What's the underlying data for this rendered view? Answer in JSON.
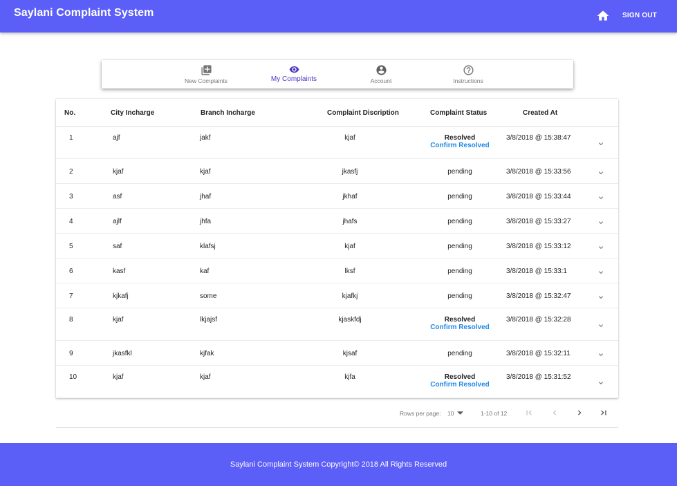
{
  "header": {
    "title": "Saylani Complaint System",
    "home_icon": "home-icon",
    "signout_label": "SIGN OUT",
    "color": "#5b5ef7"
  },
  "tabs": [
    {
      "label": "New Complaints",
      "icon": "add-box-icon",
      "active": false
    },
    {
      "label": "My Complaints",
      "icon": "eye-icon",
      "active": true
    },
    {
      "label": "Account",
      "icon": "account-circle-icon",
      "active": false
    },
    {
      "label": "Instructions",
      "icon": "help-icon",
      "active": false
    }
  ],
  "table": {
    "headers": [
      "No.",
      "City Incharge",
      "Branch Incharge",
      "Complaint Discription",
      "Complaint Status",
      "Created At"
    ],
    "rows": [
      {
        "no": "1",
        "city": "ajf",
        "branch": "jakf",
        "desc": "kjaf",
        "status": "Resolved",
        "confirm": "Confirm Resolved",
        "created": "3/8/2018 @ 15:38:47"
      },
      {
        "no": "2",
        "city": "kjaf",
        "branch": "kjaf",
        "desc": "jkasfj",
        "status": "pending",
        "confirm": "",
        "created": "3/8/2018 @ 15:33:56"
      },
      {
        "no": "3",
        "city": "asf",
        "branch": "jhaf",
        "desc": "jkhaf",
        "status": "pending",
        "confirm": "",
        "created": "3/8/2018 @ 15:33:44"
      },
      {
        "no": "4",
        "city": "ajlf",
        "branch": "jhfa",
        "desc": "jhafs",
        "status": "pending",
        "confirm": "",
        "created": "3/8/2018 @ 15:33:27"
      },
      {
        "no": "5",
        "city": "saf",
        "branch": "klafsj",
        "desc": "kjaf",
        "status": "pending",
        "confirm": "",
        "created": "3/8/2018 @ 15:33:12"
      },
      {
        "no": "6",
        "city": "kasf",
        "branch": "kaf",
        "desc": "lksf",
        "status": "pending",
        "confirm": "",
        "created": "3/8/2018 @ 15:33:1"
      },
      {
        "no": "7",
        "city": "kjkafj",
        "branch": "some",
        "desc": "kjafkj",
        "status": "pending",
        "confirm": "",
        "created": "3/8/2018 @ 15:32:47"
      },
      {
        "no": "8",
        "city": "kjaf",
        "branch": "lkjajsf",
        "desc": "kjaskfdj",
        "status": "Resolved",
        "confirm": "Confirm Resolved",
        "created": "3/8/2018 @ 15:32:28"
      },
      {
        "no": "9",
        "city": "jkasfkl",
        "branch": "kjfak",
        "desc": "kjsaf",
        "status": "pending",
        "confirm": "",
        "created": "3/8/2018 @ 15:32:11"
      },
      {
        "no": "10",
        "city": "kjaf",
        "branch": "kjaf",
        "desc": "kjfa",
        "status": "Resolved",
        "confirm": "Confirm Resolved",
        "created": "3/8/2018 @ 15:31:52"
      }
    ],
    "expand_icon": "chevron-down-icon"
  },
  "pagination": {
    "rows_per_page_label": "Rows per page:",
    "rows_per_page_value": "10",
    "range": "1-10 of 12",
    "icons": [
      "first-page-icon",
      "prev-page-icon",
      "next-page-icon",
      "last-page-icon"
    ]
  },
  "footer": {
    "text": "Saylani Complaint System Copyright© 2018 All Rights Reserved"
  }
}
